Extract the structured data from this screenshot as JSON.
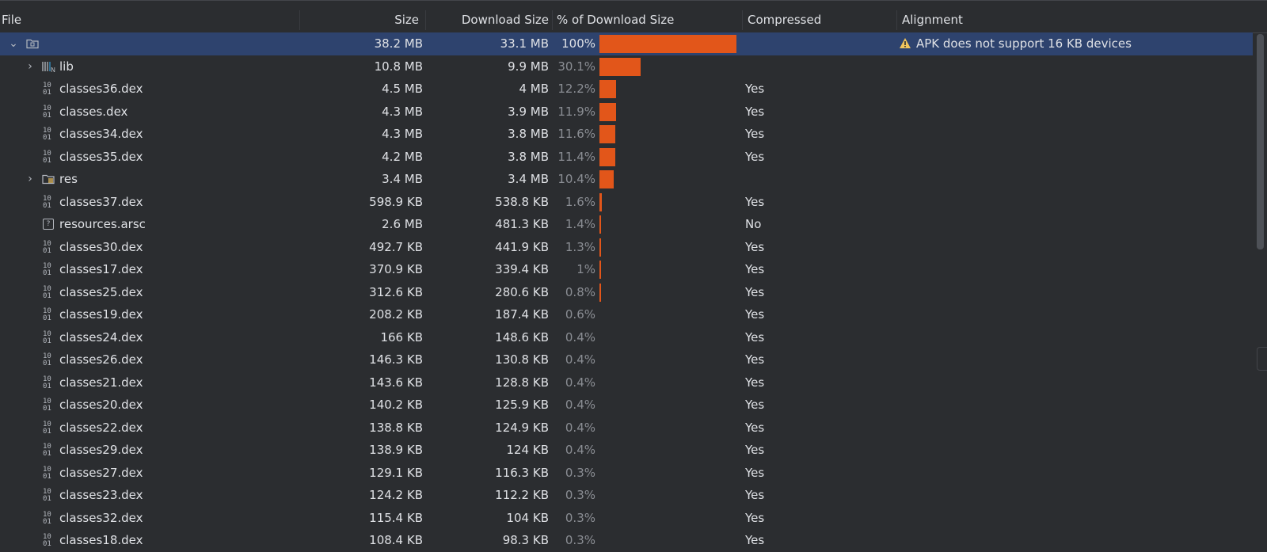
{
  "columns": {
    "file": "File",
    "size": "Size",
    "download_size": "Download Size",
    "percent": "% of Download Size",
    "compressed": "Compressed",
    "alignment": "Alignment"
  },
  "colors": {
    "bar": "#e2561a",
    "selected_row": "#2e436e",
    "warning": "#f2c55c"
  },
  "rows": [
    {
      "name": "",
      "icon": "folder-icon",
      "expand": "down",
      "size": "38.2 MB",
      "download_size": "33.1 MB",
      "percent": "100%",
      "bar_fraction": 1.0,
      "compressed": "",
      "alignment": "APK does not support 16 KB devices",
      "selected": true
    },
    {
      "name": "lib",
      "icon": "native-lib-icon",
      "expand": "right",
      "size": "10.8 MB",
      "download_size": "9.9 MB",
      "percent": "30.1%",
      "bar_fraction": 0.301,
      "compressed": "",
      "alignment": ""
    },
    {
      "name": "classes36.dex",
      "icon": "dex-icon",
      "size": "4.5 MB",
      "download_size": "4 MB",
      "percent": "12.2%",
      "bar_fraction": 0.122,
      "compressed": "Yes",
      "alignment": ""
    },
    {
      "name": "classes.dex",
      "icon": "dex-icon",
      "size": "4.3 MB",
      "download_size": "3.9 MB",
      "percent": "11.9%",
      "bar_fraction": 0.119,
      "compressed": "Yes",
      "alignment": ""
    },
    {
      "name": "classes34.dex",
      "icon": "dex-icon",
      "size": "4.3 MB",
      "download_size": "3.8 MB",
      "percent": "11.6%",
      "bar_fraction": 0.116,
      "compressed": "Yes",
      "alignment": ""
    },
    {
      "name": "classes35.dex",
      "icon": "dex-icon",
      "size": "4.2 MB",
      "download_size": "3.8 MB",
      "percent": "11.4%",
      "bar_fraction": 0.114,
      "compressed": "Yes",
      "alignment": ""
    },
    {
      "name": "res",
      "icon": "res-folder-icon",
      "expand": "right",
      "size": "3.4 MB",
      "download_size": "3.4 MB",
      "percent": "10.4%",
      "bar_fraction": 0.104,
      "compressed": "",
      "alignment": ""
    },
    {
      "name": "classes37.dex",
      "icon": "dex-icon",
      "size": "598.9 KB",
      "download_size": "538.8 KB",
      "percent": "1.6%",
      "bar_fraction": 0.016,
      "compressed": "Yes",
      "alignment": ""
    },
    {
      "name": "resources.arsc",
      "icon": "unknown-file-icon",
      "size": "2.6 MB",
      "download_size": "481.3 KB",
      "percent": "1.4%",
      "bar_fraction": 0.014,
      "compressed": "No",
      "alignment": ""
    },
    {
      "name": "classes30.dex",
      "icon": "dex-icon",
      "size": "492.7 KB",
      "download_size": "441.9 KB",
      "percent": "1.3%",
      "bar_fraction": 0.013,
      "compressed": "Yes",
      "alignment": ""
    },
    {
      "name": "classes17.dex",
      "icon": "dex-icon",
      "size": "370.9 KB",
      "download_size": "339.4 KB",
      "percent": "1%",
      "bar_fraction": 0.01,
      "compressed": "Yes",
      "alignment": ""
    },
    {
      "name": "classes25.dex",
      "icon": "dex-icon",
      "size": "312.6 KB",
      "download_size": "280.6 KB",
      "percent": "0.8%",
      "bar_fraction": 0.008,
      "compressed": "Yes",
      "alignment": ""
    },
    {
      "name": "classes19.dex",
      "icon": "dex-icon",
      "size": "208.2 KB",
      "download_size": "187.4 KB",
      "percent": "0.6%",
      "bar_fraction": 0.0,
      "compressed": "Yes",
      "alignment": ""
    },
    {
      "name": "classes24.dex",
      "icon": "dex-icon",
      "size": "166 KB",
      "download_size": "148.6 KB",
      "percent": "0.4%",
      "bar_fraction": 0.0,
      "compressed": "Yes",
      "alignment": ""
    },
    {
      "name": "classes26.dex",
      "icon": "dex-icon",
      "size": "146.3 KB",
      "download_size": "130.8 KB",
      "percent": "0.4%",
      "bar_fraction": 0.0,
      "compressed": "Yes",
      "alignment": ""
    },
    {
      "name": "classes21.dex",
      "icon": "dex-icon",
      "size": "143.6 KB",
      "download_size": "128.8 KB",
      "percent": "0.4%",
      "bar_fraction": 0.0,
      "compressed": "Yes",
      "alignment": ""
    },
    {
      "name": "classes20.dex",
      "icon": "dex-icon",
      "size": "140.2 KB",
      "download_size": "125.9 KB",
      "percent": "0.4%",
      "bar_fraction": 0.0,
      "compressed": "Yes",
      "alignment": ""
    },
    {
      "name": "classes22.dex",
      "icon": "dex-icon",
      "size": "138.8 KB",
      "download_size": "124.9 KB",
      "percent": "0.4%",
      "bar_fraction": 0.0,
      "compressed": "Yes",
      "alignment": ""
    },
    {
      "name": "classes29.dex",
      "icon": "dex-icon",
      "size": "138.9 KB",
      "download_size": "124 KB",
      "percent": "0.4%",
      "bar_fraction": 0.0,
      "compressed": "Yes",
      "alignment": ""
    },
    {
      "name": "classes27.dex",
      "icon": "dex-icon",
      "size": "129.1 KB",
      "download_size": "116.3 KB",
      "percent": "0.3%",
      "bar_fraction": 0.0,
      "compressed": "Yes",
      "alignment": ""
    },
    {
      "name": "classes23.dex",
      "icon": "dex-icon",
      "size": "124.2 KB",
      "download_size": "112.2 KB",
      "percent": "0.3%",
      "bar_fraction": 0.0,
      "compressed": "Yes",
      "alignment": ""
    },
    {
      "name": "classes32.dex",
      "icon": "dex-icon",
      "size": "115.4 KB",
      "download_size": "104 KB",
      "percent": "0.3%",
      "bar_fraction": 0.0,
      "compressed": "Yes",
      "alignment": ""
    },
    {
      "name": "classes18.dex",
      "icon": "dex-icon",
      "size": "108.4 KB",
      "download_size": "98.3 KB",
      "percent": "0.3%",
      "bar_fraction": 0.0,
      "compressed": "Yes",
      "alignment": ""
    }
  ]
}
